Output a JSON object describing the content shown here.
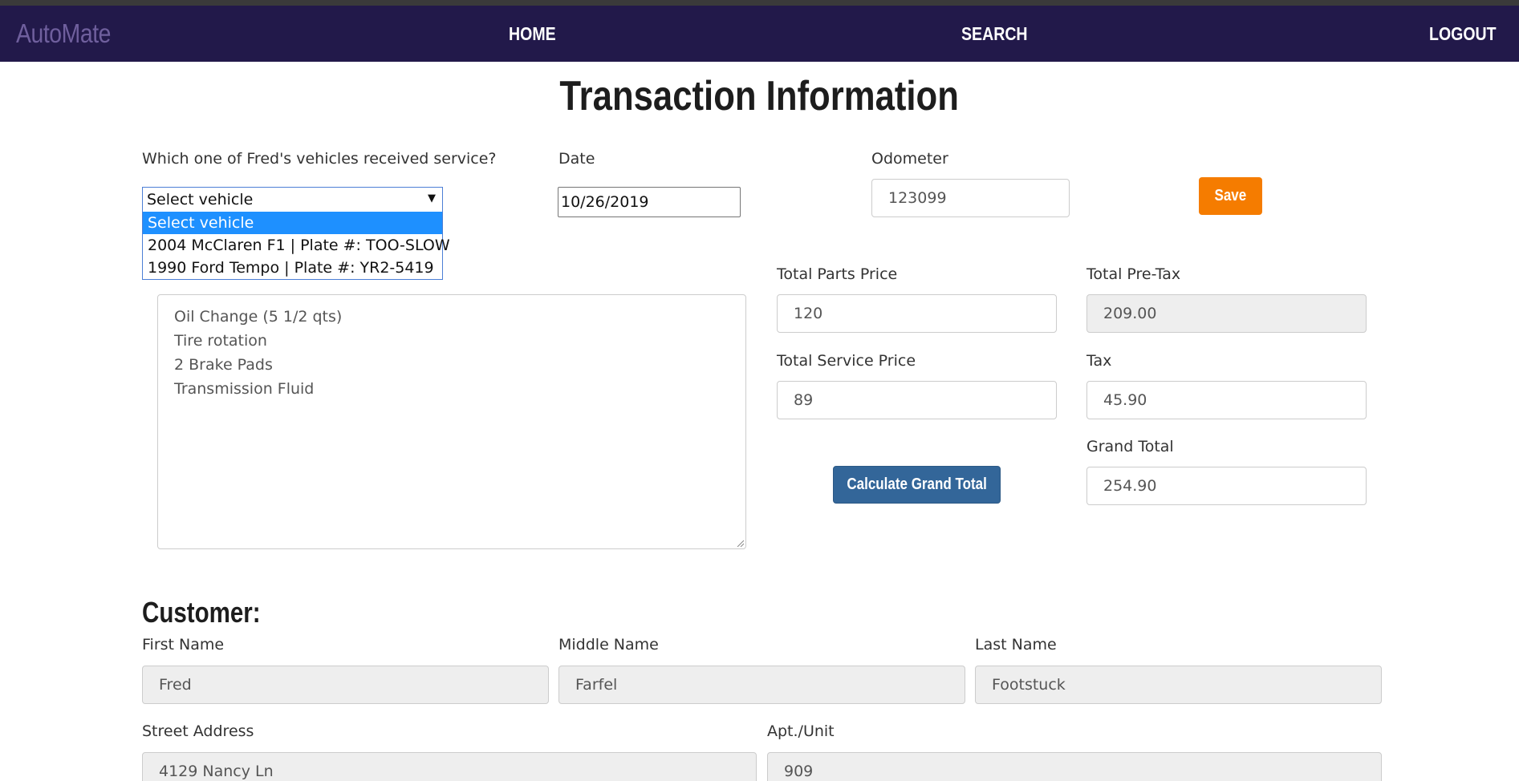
{
  "nav": {
    "brand": "AutoMate",
    "links": [
      "HOME",
      "SEARCH",
      "LOGOUT"
    ]
  },
  "page": {
    "title": "Transaction Information"
  },
  "vehicle": {
    "label": "Which one of Fred's vehicles received service?",
    "selected": "Select vehicle",
    "options": [
      "Select vehicle",
      "2004 McClaren F1 | Plate #: TOO-SLOW",
      "1990 Ford Tempo | Plate #: YR2-5419"
    ]
  },
  "date": {
    "label": "Date",
    "value": "10/26/2019"
  },
  "odometer": {
    "label": "Odometer",
    "value": "123099"
  },
  "save_label": "Save",
  "services": {
    "lines": [
      "Oil Change (5 1/2 qts)",
      "Tire rotation",
      "2 Brake Pads",
      "Transmission Fluid"
    ]
  },
  "pricing": {
    "parts": {
      "label": "Total Parts Price",
      "value": "120"
    },
    "service": {
      "label": "Total Service Price",
      "value": "89"
    },
    "pretax": {
      "label": "Total Pre-Tax",
      "value": "209.00"
    },
    "tax": {
      "label": "Tax",
      "value": "45.90"
    },
    "grand_total": {
      "label": "Grand Total",
      "value": "254.90"
    },
    "calculate_label": "Calculate Grand Total"
  },
  "customer": {
    "title": "Customer:",
    "first_name": {
      "label": "First Name",
      "value": "Fred"
    },
    "middle_name": {
      "label": "Middle Name",
      "value": "Farfel"
    },
    "last_name": {
      "label": "Last Name",
      "value": "Footstuck"
    },
    "street": {
      "label": "Street Address",
      "value": "4129 Nancy Ln"
    },
    "unit": {
      "label": "Apt./Unit",
      "value": "909"
    }
  },
  "colors": {
    "navbar": "#22194a",
    "brand": "#6f5f9d",
    "save_button": "#f57c00",
    "calculate_button": "#336699",
    "selected_option": "#1e90ff",
    "readonly_field": "#eeeeee"
  }
}
